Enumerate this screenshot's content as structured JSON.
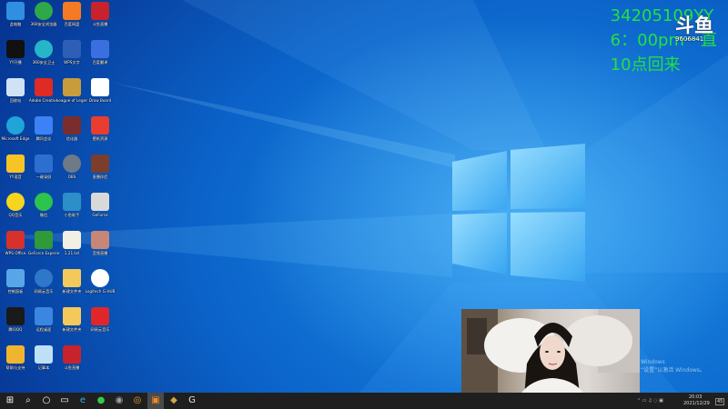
{
  "overlay": {
    "lines": [
      "34205109YY",
      "6：00pm一直",
      "10点回来"
    ],
    "color": "#22e043"
  },
  "douyu_logo": {
    "mark": "斗鱼",
    "room_id": "9606841"
  },
  "desktop": {
    "wallpaper_colors": [
      "#1c8ee8",
      "#0b63c9",
      "#06318e"
    ],
    "icons": [
      {
        "label": "此电脑",
        "icon": "computer-icon",
        "color": "#2f8fe0"
      },
      {
        "label": "360安全浏览器",
        "icon": "browser-360-icon",
        "color": "#2fa84a"
      },
      {
        "label": "百度网盘",
        "icon": "baidu-netdisk-icon",
        "color": "#f47b23"
      },
      {
        "label": "斗鱼直播",
        "icon": "douyu-app-icon",
        "color": "#c8232c"
      },
      {
        "label": "YY开播",
        "icon": "yy-live-icon",
        "color": "#111111"
      },
      {
        "label": "360安全卫士",
        "icon": "security-360-icon",
        "color": "#27b5c8"
      },
      {
        "label": "WPS文字",
        "icon": "document-icon",
        "color": "#2d5fb7"
      },
      {
        "label": "百度翻译",
        "icon": "baidu-icon",
        "color": "#3b6fe0"
      },
      {
        "label": "回收站",
        "icon": "recycle-bin-icon",
        "color": "#cfe3f5"
      },
      {
        "label": "Adobe Creative",
        "icon": "adobe-cloud-icon",
        "color": "#e02a24"
      },
      {
        "label": "League of Legends",
        "icon": "league-icon",
        "color": "#c99c3b"
      },
      {
        "label": "Draw Board",
        "icon": "pen-icon",
        "color": "#ffffff"
      },
      {
        "label": "Microsoft Edge",
        "icon": "edge-icon",
        "color": "#1fa5d8"
      },
      {
        "label": "腾讯会议",
        "icon": "meeting-icon",
        "color": "#3c82f6"
      },
      {
        "label": "优化器",
        "icon": "photo-icon",
        "color": "#7a2d2d"
      },
      {
        "label": "壁纸资源",
        "icon": "pdf-icon",
        "color": "#e83d2f"
      },
      {
        "label": "YY语音",
        "icon": "yy-voice-icon",
        "color": "#f6c425"
      },
      {
        "label": "一键录屏",
        "icon": "recorder-icon",
        "color": "#2d6fd1"
      },
      {
        "label": "OBS",
        "icon": "obs-icon",
        "color": "#6e7a87"
      },
      {
        "label": "直播伴侣",
        "icon": "live-partner-icon",
        "color": "#7b3d2c"
      },
      {
        "label": "QQ音乐",
        "icon": "qq-music-icon",
        "color": "#f7d51f"
      },
      {
        "label": "微信",
        "icon": "wechat-icon",
        "color": "#2cc44c"
      },
      {
        "label": "小鱼助手",
        "icon": "fish-icon",
        "color": "#2c8fc7"
      },
      {
        "label": "GeForce",
        "icon": "game-icon",
        "color": "#d9d9d9"
      },
      {
        "label": "WPS Office",
        "icon": "wps-icon",
        "color": "#d6322b"
      },
      {
        "label": "GeForce Experience",
        "icon": "nvidia-icon",
        "color": "#2f9a37"
      },
      {
        "label": "1.21.txt",
        "icon": "text-file-icon",
        "color": "#f2efe4"
      },
      {
        "label": "音频直播",
        "icon": "avatar-file-icon",
        "color": "#c78676"
      },
      {
        "label": "控制面板",
        "icon": "control-panel-icon",
        "color": "#58a6e8"
      },
      {
        "label": "网易云音乐",
        "icon": "cloud-music-icon",
        "color": "#2e78c9"
      },
      {
        "label": "新建文件夹",
        "icon": "folder-icon",
        "color": "#f3c95b"
      },
      {
        "label": "Logitech G HUB",
        "icon": "logitech-icon",
        "color": "#ffffff"
      },
      {
        "label": "腾讯QQ",
        "icon": "qq-icon",
        "color": "#1a1a1a"
      },
      {
        "label": "远程桌面",
        "icon": "remote-desktop-icon",
        "color": "#3a86e0"
      },
      {
        "label": "新建文件夹",
        "icon": "folder-icon",
        "color": "#f3c95b"
      },
      {
        "label": "网易云音乐",
        "icon": "netease-music-icon",
        "color": "#e0262b"
      },
      {
        "label": "帮助与支持",
        "icon": "help-icon",
        "color": "#f0b52f"
      },
      {
        "label": "记事本",
        "icon": "notepad-icon",
        "color": "#bde0f7"
      },
      {
        "label": "斗鱼直播",
        "icon": "douyu-app-icon",
        "color": "#c8232c"
      }
    ]
  },
  "activation": {
    "line1": "Windows",
    "line2": "“设置”以激活 Windows。"
  },
  "taskbar": {
    "items": [
      {
        "name": "start-button",
        "icon": "windows-start-icon"
      },
      {
        "name": "search-button",
        "icon": "search-icon"
      },
      {
        "name": "cortana-button",
        "icon": "cortana-icon"
      },
      {
        "name": "task-view-button",
        "icon": "task-view-icon"
      },
      {
        "name": "edge-taskbar",
        "icon": "edge-icon"
      },
      {
        "name": "wechat-taskbar",
        "icon": "wechat-icon"
      },
      {
        "name": "app-taskbar",
        "icon": "circle-app-icon"
      },
      {
        "name": "obs-taskbar",
        "icon": "obs-icon"
      },
      {
        "name": "douyu-taskbar",
        "icon": "douyu-app-icon"
      },
      {
        "name": "league-taskbar",
        "icon": "league-icon"
      },
      {
        "name": "logitech-taskbar",
        "icon": "logitech-icon"
      }
    ],
    "time": "20:03",
    "date": "2021/12/29",
    "notification_count": "45"
  }
}
